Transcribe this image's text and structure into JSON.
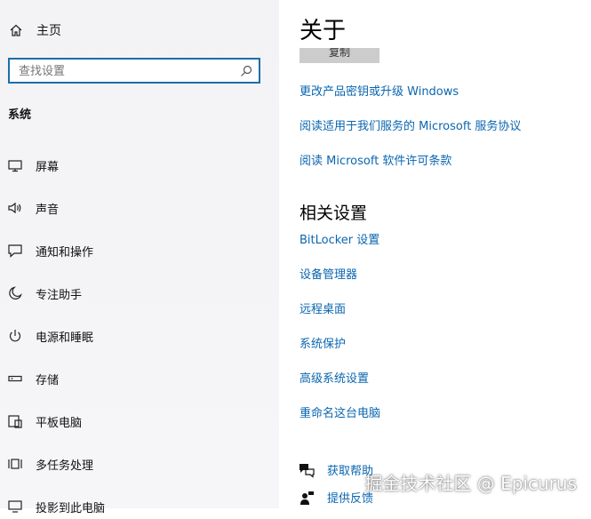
{
  "sidebar": {
    "home_label": "主页",
    "search_placeholder": "查找设置",
    "section_title": "系统",
    "items": [
      {
        "label": "屏幕",
        "icon": "monitor-icon"
      },
      {
        "label": "声音",
        "icon": "speaker-icon"
      },
      {
        "label": "通知和操作",
        "icon": "notification-icon"
      },
      {
        "label": "专注助手",
        "icon": "moon-icon"
      },
      {
        "label": "电源和睡眠",
        "icon": "power-icon"
      },
      {
        "label": "存储",
        "icon": "storage-icon"
      },
      {
        "label": "平板电脑",
        "icon": "tablet-icon"
      },
      {
        "label": "多任务处理",
        "icon": "multitask-icon"
      },
      {
        "label": "投影到此电脑",
        "icon": "project-icon"
      }
    ]
  },
  "main": {
    "title": "关于",
    "copy_button": "复制",
    "links": [
      "更改产品密钥或升级 Windows",
      "阅读适用于我们服务的 Microsoft 服务协议",
      "阅读 Microsoft 软件许可条款"
    ],
    "related_title": "相关设置",
    "related_links": [
      "BitLocker 设置",
      "设备管理器",
      "远程桌面",
      "系统保护",
      "高级系统设置",
      "重命名这台电脑"
    ],
    "help_links": [
      {
        "label": "获取帮助",
        "icon": "help-chat-icon"
      },
      {
        "label": "提供反馈",
        "icon": "feedback-icon"
      }
    ]
  },
  "watermark": "掘金技术社区 @ Epicurus",
  "colors": {
    "link": "#0a66b0",
    "search_border": "#1b6fa8",
    "sidebar_bg": "#f3f3f6"
  }
}
